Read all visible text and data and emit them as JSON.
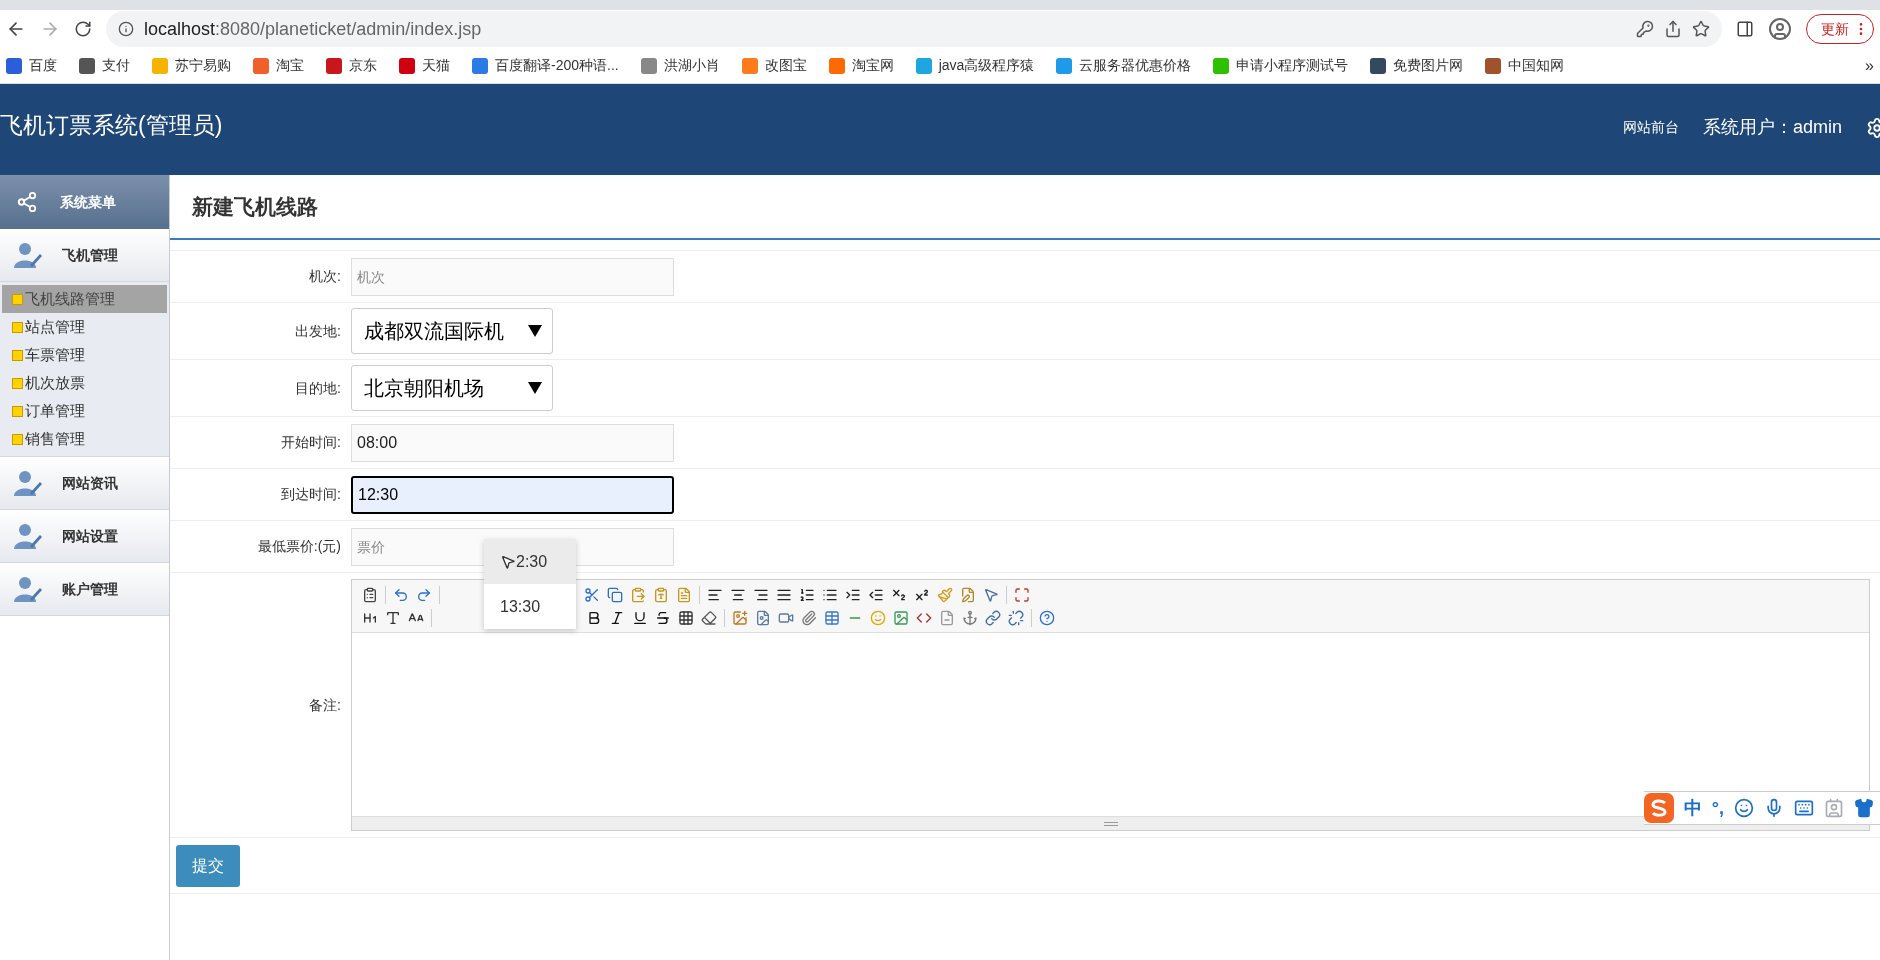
{
  "browser": {
    "address_host": "localhost",
    "address_path": ":8080/planeticket/admin/index.jsp",
    "update_button": "更新",
    "bookmarks": [
      {
        "label": "百度",
        "color": "#2b5fd9"
      },
      {
        "label": "支付",
        "color": "#555555"
      },
      {
        "label": "苏宁易购",
        "color": "#f5b400"
      },
      {
        "label": "淘宝",
        "color": "#f0602a"
      },
      {
        "label": "京东",
        "color": "#c8161d"
      },
      {
        "label": "天猫",
        "color": "#d00010"
      },
      {
        "label": "百度翻译-200种语...",
        "color": "#2a7be4"
      },
      {
        "label": "洪湖小肖",
        "color": "#888888"
      },
      {
        "label": "改图宝",
        "color": "#ff7a1a"
      },
      {
        "label": "淘宝网",
        "color": "#ff6a00"
      },
      {
        "label": "java高级程序猿",
        "color": "#1fa5e0"
      },
      {
        "label": "云服务器优惠价格",
        "color": "#1e9be8"
      },
      {
        "label": "申请小程序测试号",
        "color": "#2dc100"
      },
      {
        "label": "免费图片网",
        "color": "#34495e"
      },
      {
        "label": "中国知网",
        "color": "#a0522d"
      }
    ],
    "more": "»"
  },
  "header": {
    "title": "飞机订票系统(管理员)",
    "front_link": "网站前台",
    "user": "系统用户：admin"
  },
  "sidebar": {
    "title": "系统菜单",
    "groups": [
      {
        "label": "飞机管理",
        "children": [
          {
            "label": "飞机线路管理",
            "selected": true
          },
          {
            "label": "站点管理",
            "selected": false
          },
          {
            "label": "车票管理",
            "selected": false
          },
          {
            "label": "机次放票",
            "selected": false
          },
          {
            "label": "订单管理",
            "selected": false
          },
          {
            "label": "销售管理",
            "selected": false
          }
        ]
      },
      {
        "label": "网站资讯"
      },
      {
        "label": "网站设置"
      },
      {
        "label": "账户管理"
      }
    ]
  },
  "page_title": "新建飞机线路",
  "form": {
    "fields": [
      {
        "kind": "text",
        "label": "机次:",
        "placeholder": "机次",
        "focused": false
      },
      {
        "kind": "select",
        "label": "出发地:",
        "value": "成都双流国际机"
      },
      {
        "kind": "select",
        "label": "目的地:",
        "value": "北京朝阳机场"
      },
      {
        "kind": "text",
        "label": "开始时间:",
        "value": "08:00",
        "focused": false
      },
      {
        "kind": "text",
        "label": "到达时间:",
        "value": "12:30",
        "focused": true
      },
      {
        "kind": "text",
        "label": "最低票价:(元)",
        "placeholder": "票价",
        "focused": false
      },
      {
        "kind": "editor",
        "label": "备注:"
      }
    ],
    "submit": "提交"
  },
  "time_dropdown": {
    "items": [
      {
        "label": "2:30",
        "selected": true
      },
      {
        "label": "13:30",
        "selected": false
      }
    ]
  },
  "ime_bar": {
    "items": [
      "中",
      "°,"
    ]
  }
}
